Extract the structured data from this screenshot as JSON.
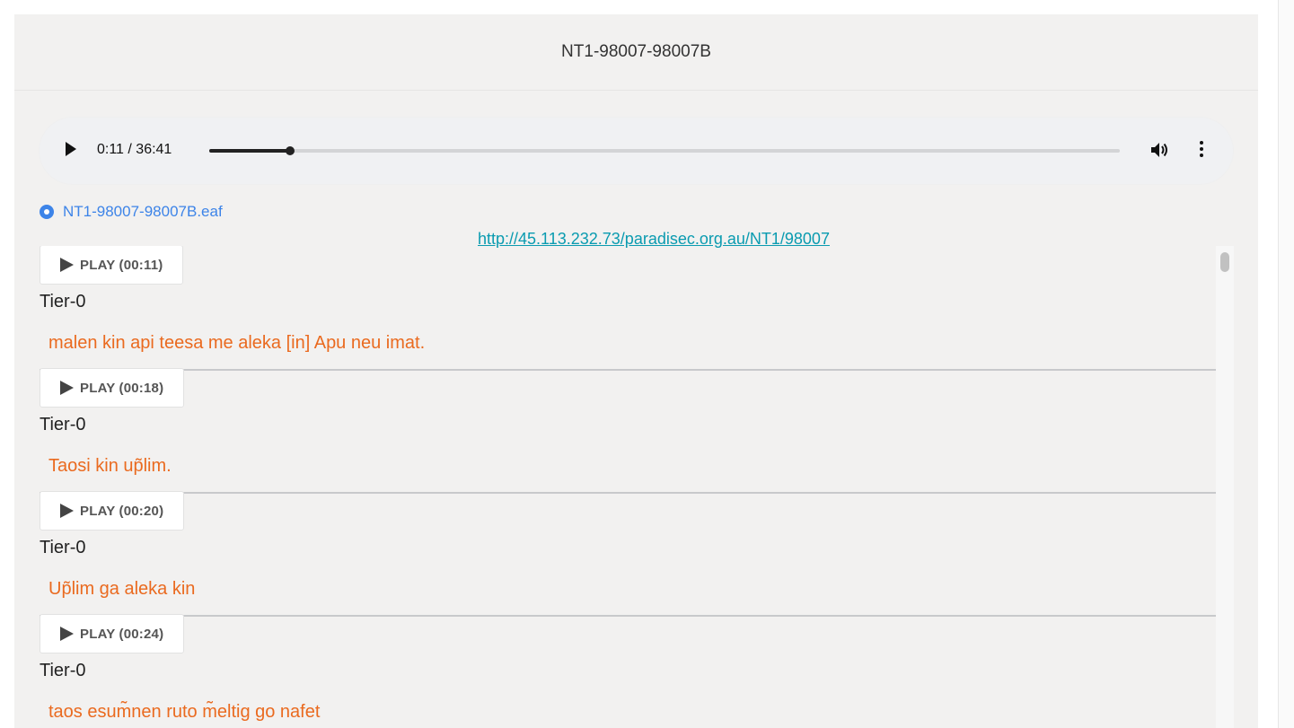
{
  "header": {
    "title": "NT1-98007-98007B"
  },
  "audio": {
    "current_time": "0:11",
    "duration": "36:41",
    "time_label": "0:11 / 36:41",
    "progress_fraction": 0.089
  },
  "eaf_file": {
    "label": "NT1-98007-98007B.eaf"
  },
  "source_link": {
    "text": "http://45.113.232.73/paradisec.org.au/NT1/98007"
  },
  "segments": [
    {
      "play_label": "PLAY (00:11)",
      "tier": "Tier-0",
      "text": "malen kin api teesa me aleka [in] Apu neu imat."
    },
    {
      "play_label": "PLAY (00:18)",
      "tier": "Tier-0",
      "text": "Taosi kin up̃lim."
    },
    {
      "play_label": "PLAY (00:20)",
      "tier": "Tier-0",
      "text": "Up̃lim ga aleka kin"
    },
    {
      "play_label": "PLAY (00:24)",
      "tier": "Tier-0",
      "text": "taos esum̃nen ruto m̃eltig go nafet"
    }
  ],
  "colors": {
    "accent_link": "#3d84e8",
    "utterance": "#ea6a1f",
    "url": "#0a9bb0"
  }
}
